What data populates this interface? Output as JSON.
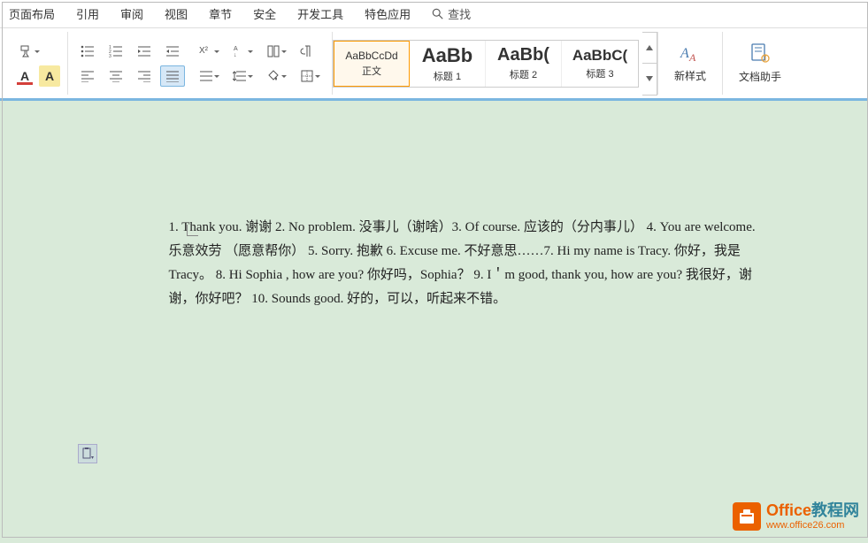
{
  "tabs": {
    "items": [
      "页面布局",
      "引用",
      "审阅",
      "视图",
      "章节",
      "安全",
      "开发工具",
      "特色应用"
    ],
    "search": "查找"
  },
  "toolbar": {
    "font_color": {
      "letter": "A",
      "color": "#d43f3a"
    },
    "highlight": {
      "letter": "A",
      "color": "#ffe08a"
    }
  },
  "styles": {
    "items": [
      {
        "preview": "AaBbCcDd",
        "label": "正文",
        "size": "12px",
        "weight": "normal",
        "active": true
      },
      {
        "preview": "AaBb",
        "label": "标题 1",
        "size": "22px",
        "weight": "bold",
        "active": false
      },
      {
        "preview": "AaBb(",
        "label": "标题 2",
        "size": "20px",
        "weight": "bold",
        "active": false
      },
      {
        "preview": "AaBbC(",
        "label": "标题 3",
        "size": "17px",
        "weight": "bold",
        "active": false
      }
    ],
    "new_style": "新样式",
    "doc_helper": "文档助手"
  },
  "document": {
    "text": "1.      Thank you. 谢谢 2.       No problem. 没事儿（谢啥）3.       Of course. 应该的（分内事儿） 4.         You are welcome. 乐意效劳 （愿意帮你） 5.        Sorry. 抱歉  6.        Excuse me. 不好意思……7.       Hi my name is Tracy. 你好，我是 Tracy。  8.       Hi Sophia , how are you? 你好吗，Sophia？ 9.      I＇m good, thank you, how are you? 我很好，谢谢，你好吧？ 10.     Sounds good. 好的，可以，听起来不错。"
  },
  "watermark": {
    "title_prefix": "Office",
    "title_suffix": "教程网",
    "url": "www.office26.com"
  }
}
